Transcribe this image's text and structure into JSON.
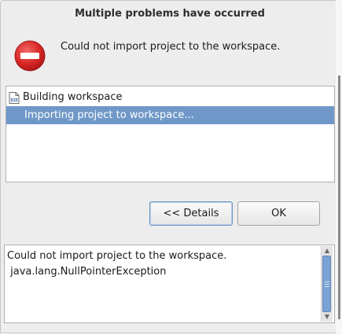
{
  "dialog": {
    "title": "Multiple problems have occurred",
    "message": "Could not import project to the workspace.",
    "icon": "error-icon",
    "error_color": "#d92727"
  },
  "problems": [
    {
      "label": "Building workspace",
      "icon": "binary-file-icon",
      "selected": false
    },
    {
      "label": "Importing project to workspace...",
      "selected": true
    }
  ],
  "buttons": {
    "details_label": "<< Details",
    "ok_label": "OK"
  },
  "details": {
    "text": "Could not import project to the workspace.\n java.lang.NullPointerException"
  },
  "colors": {
    "selection": "#6f98c8",
    "scrollbar_thumb": "#7aa3d3"
  }
}
